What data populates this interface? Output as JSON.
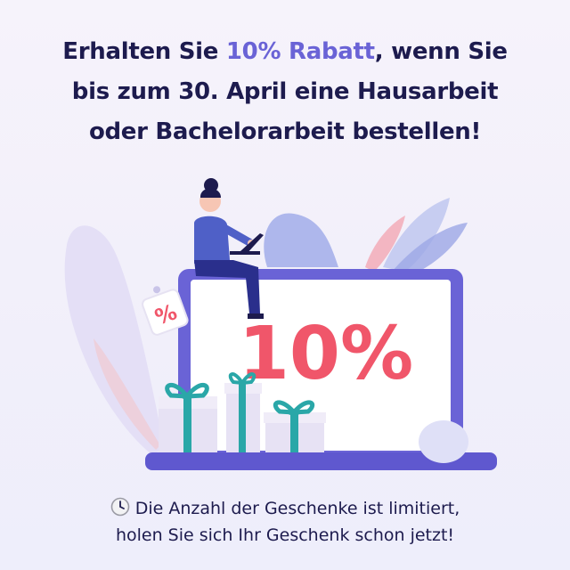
{
  "headline": {
    "part1": "Erhalten Sie ",
    "accent": "10% Rabatt",
    "part2": ", wenn Sie",
    "line2": "bis zum 30. April eine Hausarbeit",
    "line3": "oder Bachelorarbeit bestellen!"
  },
  "illustration": {
    "discount_text": "10%",
    "tag_text": "%"
  },
  "footer": {
    "line1": "Die Anzahl der Geschenke ist limitiert,",
    "line2": "holen Sie sich Ihr Geschenk schon jetzt!"
  },
  "colors": {
    "dark_navy": "#1d1b4e",
    "accent_purple": "#6a63d6",
    "discount_red": "#f0566a",
    "gift_teal": "#2aa7a8"
  },
  "icons": [
    "clock-icon",
    "percent-tag-icon",
    "gift-icon"
  ]
}
